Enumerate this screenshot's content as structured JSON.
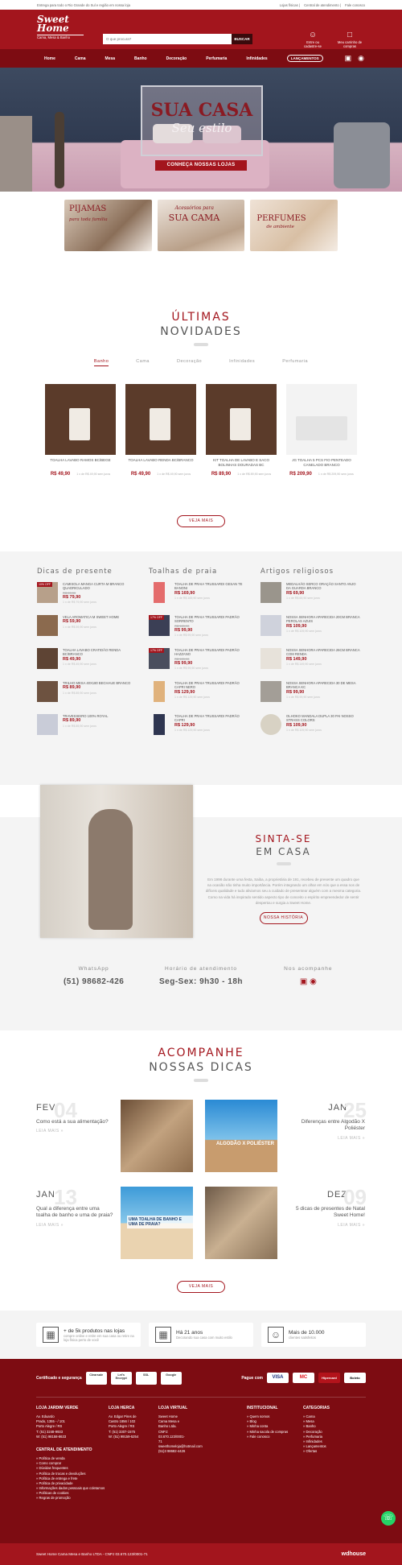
{
  "topbar": {
    "promo": "Entrega para todo o Rio Grande do Sul e região em nossa loja",
    "links": [
      "Lojas físicas",
      "Central de atendimento",
      "Fale conosco"
    ]
  },
  "header": {
    "logo_line1": "Sweet",
    "logo_line2": "Home",
    "logo_tag": "Cama, Mesa & Banho",
    "search_placeholder": "O que procura?",
    "search_button": "BUSCAR",
    "account": "Entre ou cadastre-se",
    "cart": "Meu carrinho de compras"
  },
  "nav": {
    "items": [
      "Home",
      "Cama",
      "Mesa",
      "Banho",
      "Decoração",
      "Perfumaria",
      "Infinidades"
    ],
    "pill": "LANÇAMENTOS"
  },
  "hero": {
    "title": "SUA CASA",
    "subtitle": "Seu estilo",
    "button": "CONHEÇA NOSSAS LOJAS"
  },
  "categories": [
    {
      "label": "PIJAMAS",
      "sub": "para toda família"
    },
    {
      "label": "SUA CAMA",
      "sub": "Acessórios para"
    },
    {
      "label": "PERFUMES",
      "sub": "de ambiente"
    }
  ],
  "news": {
    "title_a": "ÚLTIMAS",
    "title_b": "NOVIDADES",
    "tabs": [
      "Banho",
      "Cama",
      "Decoração",
      "Infinidades",
      "Perfumaria"
    ],
    "products": [
      {
        "name": "TOALHA LAVABO RAMOS BC/BEGE",
        "price": "R$ 49,90",
        "inst": "1 x de R$ 49,90 sem juros"
      },
      {
        "name": "TOALHA LAVABO RENDA BC/BRANCO",
        "price": "R$ 49,90",
        "inst": "1 x de R$ 49,90 sem juros"
      },
      {
        "name": "KIT TOALHA DE LAVABO E SACO BOLINHAS DOURADAS BC",
        "price": "R$ 89,90",
        "inst": "1 x de R$ 89,90 sem juros"
      },
      {
        "name": "JG TOALHA 5 PCS FIO PENTEADO CANELADO BRANCO",
        "price": "R$ 209,90",
        "inst": "1 x de R$ 209,90 sem juros"
      }
    ],
    "more": "VEJA MAIS"
  },
  "lists": [
    {
      "title": "Dicas de presente",
      "items": [
        {
          "name": "CAMISOLA MANGA CURTA M BRANCO QUADRICULADO",
          "old": "R$ 89,90",
          "price": "R$ 79,90",
          "inst": "1 x de R$ 79,90 sem juros",
          "off": "10% OFF"
        },
        {
          "name": "VELA AROMATICA M SWEET HOME",
          "old": "",
          "price": "R$ 59,90",
          "inst": "1 x de R$ 59,90 sem juros",
          "off": ""
        },
        {
          "name": "TOALHA LAVABO CRATIDÃO RENDA BC/BRANCO",
          "old": "",
          "price": "R$ 49,90",
          "inst": "1 x de R$ 49,90 sem juros",
          "off": ""
        },
        {
          "name": "TRILHO MESA 40X180 BECHAUE BRANCO",
          "old": "",
          "price": "R$ 89,90",
          "inst": "1 x de R$ 89,90 sem juros",
          "off": ""
        },
        {
          "name": "TRAVESSEIRO 100% ROYAL",
          "old": "",
          "price": "R$ 89,90",
          "inst": "1 x de R$ 89,90 sem juros",
          "off": ""
        }
      ]
    },
    {
      "title": "Toalhas de praia",
      "items": [
        {
          "name": "TOALHA DE PRAIA TRUSSARDI GESAN TE BANONI",
          "old": "",
          "price": "R$ 169,90",
          "inst": "1 x de R$ 169,90 sem juros",
          "off": ""
        },
        {
          "name": "TOALHA DE PRAIA TRUSSARDI PADRÃO SORRENTO",
          "old": "R$ 120,90",
          "price": "R$ 99,90",
          "inst": "1 x de R$ 99,90 sem juros",
          "off": "17% OFF"
        },
        {
          "name": "TOALHA DE PRAIA TRUSSARDI PADRÃO HAZZANO",
          "old": "R$ 120,90",
          "price": "R$ 99,90",
          "inst": "1 x de R$ 99,90 sem juros",
          "off": "17% OFF"
        },
        {
          "name": "TOALHA DE PRAIA TRUSSARDI PADRÃO CAPRI NERO",
          "old": "",
          "price": "R$ 129,90",
          "inst": "1 x de R$ 129,90 sem juros",
          "off": ""
        },
        {
          "name": "TOALHA DE PRAIA TRUSSARDI PADRÃO CAPRI",
          "old": "",
          "price": "R$ 129,90",
          "inst": "1 x de R$ 129,90 sem juros",
          "off": ""
        }
      ]
    },
    {
      "title": "Artigos religiosos",
      "items": [
        {
          "name": "MEDALHÃO SERCO ORAÇÃO SANTO ANJO DA GUARDA BRANCO",
          "old": "",
          "price": "R$ 69,90",
          "inst": "1 x de R$ 69,90 sem juros",
          "off": ""
        },
        {
          "name": "NOSSA SENHORA APARECIDA 20CM BRANCA PEROLAS AZUIS",
          "old": "",
          "price": "R$ 109,90",
          "inst": "1 x de R$ 109,90 sem juros",
          "off": ""
        },
        {
          "name": "NOSSA SENHORA APARECIDA 26CM BRANCA COM RENDA",
          "old": "",
          "price": "R$ 149,90",
          "inst": "1 x de R$ 149,90 sem juros",
          "off": ""
        },
        {
          "name": "NOSSA SENHORA APARECIDA 30 DE MESA BRANCA KC",
          "old": "",
          "price": "R$ 99,90",
          "inst": "1 x de R$ 99,90 sem juros",
          "off": ""
        },
        {
          "name": "OLHOKO MANDALA DUPLA 30 PAI NOSSO STRASS COLORS",
          "old": "",
          "price": "R$ 109,90",
          "inst": "1 x de R$ 109,90 sem juros",
          "off": ""
        }
      ]
    }
  ],
  "about": {
    "title_a": "SINTA-SE",
    "title_b": "EM CASA",
    "text": "Em 1998 durante uma festa, Saiba, a proprietária de 191, recebeu de presente um quadro que na ocasião não tinha muito importância. Porém integrando um olhar em nós que a essa nos de difíceis qualidade e tudo aliviamos seu a cuidado de presentear alguém com a mesma categoria. Como na vida há inspirado sentido aspecto tipo de conceito o espírito empreendedor de sentir despertou e surgia a Sweet Home.",
    "button": "NOSSA HISTÓRIA"
  },
  "contact": {
    "wa_label": "WhatsApp",
    "wa_value": "(51) 98682-426",
    "hours_label": "Horário de atendimento",
    "hours_value": "Seg-Sex: 9h30 - 18h",
    "social_label": "Nos acompanhe"
  },
  "tips": {
    "title_a": "ACOMPANHE",
    "title_b": "NOSSAS DICAS",
    "posts": [
      {
        "month": "FEV",
        "day": "04",
        "title": "Como está a sua alimentação?",
        "read": "LEIA MAIS »"
      },
      {
        "month": "JAN",
        "day": "25",
        "title": "Diferenças entre Algodão X Poliéster",
        "read": "LEIA MAIS »"
      },
      {
        "month": "JAN",
        "day": "13",
        "title": "Qual a diferença entre uma toalha de banho e uma de praia?",
        "read": "LEIA MAIS »"
      },
      {
        "month": "DEZ",
        "day": "09",
        "title": "5 dicas de presentes de Natal Sweet Home!",
        "read": "LEIA MAIS »"
      }
    ],
    "img2": "ALGODÃO X POLIÉSTER",
    "img3": "UMA TOALHA DE BANHO E UMA DE PRAIA?",
    "more": "VEJA MAIS"
  },
  "features": [
    {
      "title": "+ de 5k produtos nas lojas",
      "sub": "compre online e retire em sua casa ou retire na loja física perto de você"
    },
    {
      "title": "Há 21 anos",
      "sub": "Decorando sua casa com muito estilo"
    },
    {
      "title": "Mais de 10.000",
      "sub": "clientes satisfeitos"
    }
  ],
  "footer": {
    "cert_label": "Certificado e segurança",
    "seals": [
      "Clearsale",
      "Let's Encrypt",
      "SSL",
      "Google"
    ],
    "pay_label": "Pague com",
    "pay": [
      "VISA",
      "MC",
      "Hipercard",
      "Boleto"
    ],
    "cols": [
      {
        "h": "LOJA JARDIM VERDE",
        "lines": [
          "Av. Eduardo",
          "Prado, 1355 - / 101",
          "Porto Alegre / RS",
          "T: (51) 3248-9933",
          "W: (51) 98158-8633"
        ]
      },
      {
        "h": "LOJA HERCA",
        "lines": [
          "Av. Edgar Pires de",
          "Castro 1856 / 102",
          "Porto Alegre / RS",
          "T: (51) 3307-1575",
          "W: (51) 99159-5254"
        ]
      },
      {
        "h": "LOJA VIRTUAL",
        "lines": [
          "Sweet Home",
          "Cama Mesa e",
          "Banho Ltda.",
          "CNPJ:",
          "03.670.123/0001-",
          "71",
          "sweethomeloja@hotmail.com",
          "(51)3 98682-4426"
        ]
      },
      {
        "h": "INSTITUCIONAL",
        "lines": [
          "» Quem somos",
          "» Blog",
          "» Minha conta",
          "» Minha sacola de compras",
          "» Fale conosco"
        ]
      },
      {
        "h": "CATEGORIAS",
        "lines": [
          "» Cama",
          "» Mesa",
          "» Banho",
          "» Decoração",
          "» Perfumaria",
          "» Infinidades",
          "» Lançamentos",
          "» Ofertas"
        ]
      }
    ],
    "central": {
      "h": "CENTRAL DE ATENDIMENTO",
      "lines": [
        "» Política de venda",
        "» Como comprar",
        "» Dúvidas frequentes",
        "» Política de trocas e devoluções",
        "» Política de entrega e frete",
        "» Política de privacidade",
        "» Informações dados pessoais que coletamos",
        "» Políticas de cookies",
        "» Regras de promoção"
      ]
    },
    "copyright": "Sweet Home Cama Mesa e Banho LTDA - CNPJ 03.670.123/0001-71",
    "brand": "wdhouse"
  }
}
